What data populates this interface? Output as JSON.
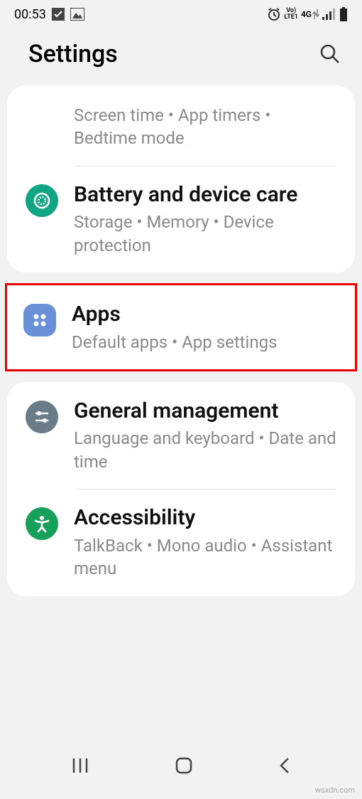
{
  "statusbar": {
    "time": "00:53",
    "network": "4G",
    "carrier_top": "Vo)",
    "carrier_bot": "LTE1"
  },
  "header": {
    "title": "Settings"
  },
  "section1": {
    "item0": {
      "sub": "Screen time  •  App timers  •  Bedtime mode"
    },
    "item1": {
      "title": "Battery and device care",
      "sub": "Storage  •  Memory  •  Device protection"
    }
  },
  "section2": {
    "item0": {
      "title": "Apps",
      "sub": "Default apps  •  App settings"
    }
  },
  "section3": {
    "item0": {
      "title": "General management",
      "sub": "Language and keyboard  •  Date and time"
    },
    "item1": {
      "title": "Accessibility",
      "sub": "TalkBack  •  Mono audio  •  Assistant menu"
    }
  },
  "watermark": "wsxdn.com"
}
